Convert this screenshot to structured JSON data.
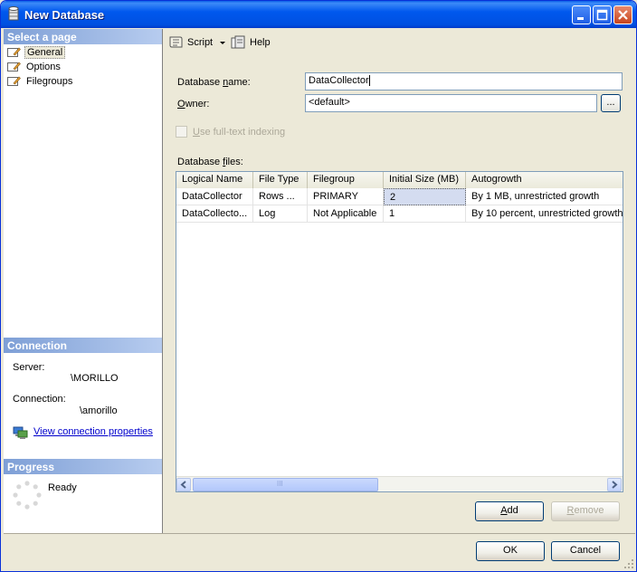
{
  "window": {
    "title": "New Database"
  },
  "left": {
    "select_page_header": "Select a page",
    "pages": [
      {
        "label": "General",
        "selected": true
      },
      {
        "label": "Options",
        "selected": false
      },
      {
        "label": "Filegroups",
        "selected": false
      }
    ],
    "connection_header": "Connection",
    "server_label": "Server:",
    "server_value": "\\MORILLO",
    "connection_label": "Connection:",
    "connection_value": "\\amorillo",
    "view_connection_link": "View connection properties",
    "progress_header": "Progress",
    "progress_status": "Ready"
  },
  "toolbar": {
    "script_label": "Script",
    "help_label": "Help"
  },
  "form": {
    "db_name_label_pre": "Database ",
    "db_name_label_u": "n",
    "db_name_label_post": "ame:",
    "db_name_value": "DataCollector",
    "owner_label_u": "O",
    "owner_label_post": "wner:",
    "owner_value": "<default>",
    "browse_label": "...",
    "fulltext_label_u": "U",
    "fulltext_label_post": "se full-text indexing",
    "db_files_label_pre": "Database ",
    "db_files_label_u": "f",
    "db_files_label_post": "iles:"
  },
  "grid": {
    "columns": [
      "Logical Name",
      "File Type",
      "Filegroup",
      "Initial Size (MB)",
      "Autogrowth"
    ],
    "rows": [
      [
        "DataCollector",
        "Rows ...",
        "PRIMARY",
        "2",
        "By 1 MB, unrestricted growth"
      ],
      [
        "DataCollecto...",
        "Log",
        "Not Applicable",
        "1",
        "By 10 percent, unrestricted growth"
      ]
    ],
    "scroll_thumb_grip": "III"
  },
  "buttons": {
    "add_u": "A",
    "add_post": "dd",
    "remove_u": "R",
    "remove_post": "emove",
    "ok": "OK",
    "cancel": "Cancel"
  },
  "colors": {
    "titlebar": "#0054e3",
    "section_header": "#7e9fd6",
    "link": "#0000cc",
    "selected_cell": "#d4dcf0"
  }
}
